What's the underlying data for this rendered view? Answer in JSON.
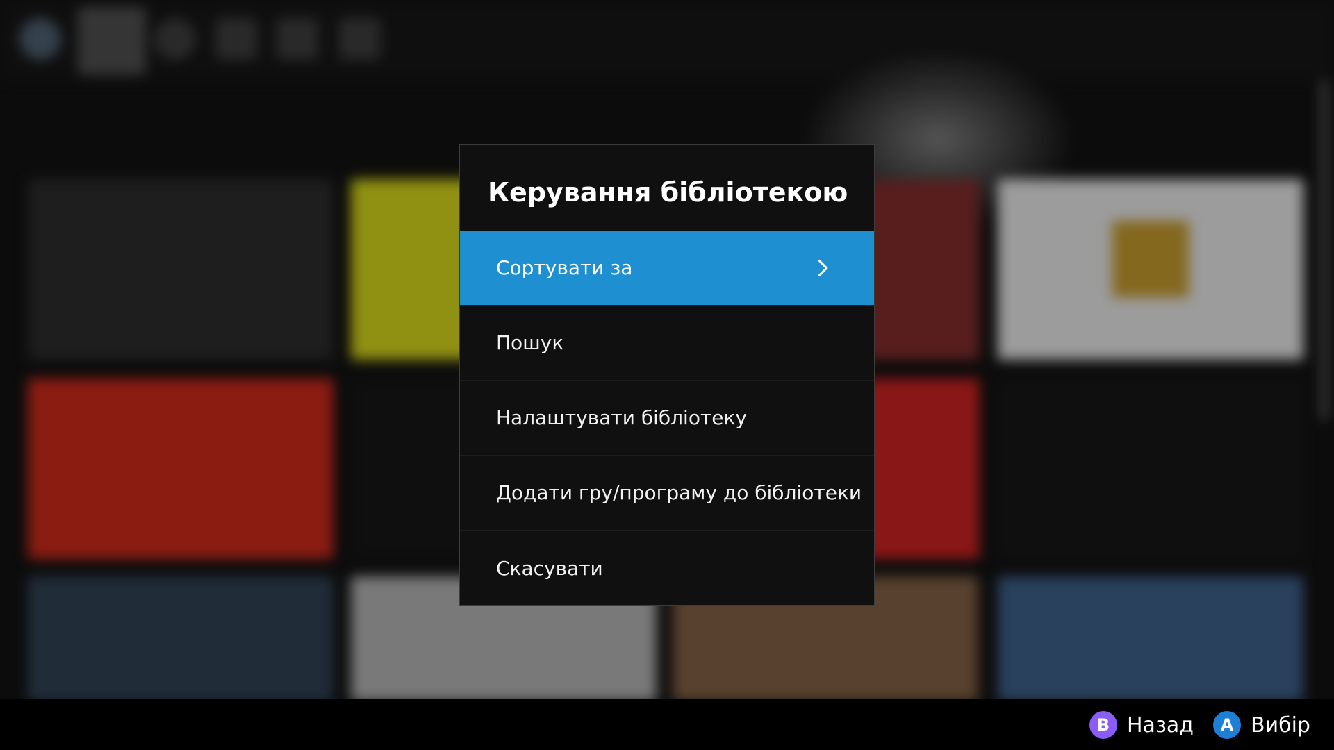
{
  "menu": {
    "title": "Керування бібліотекою",
    "items": [
      {
        "label": "Сортувати за",
        "selected": true,
        "has_submenu": true
      },
      {
        "label": "Пошук"
      },
      {
        "label": "Налаштувати бібліотеку"
      },
      {
        "label": "Додати гру/програму до бібліотеки"
      },
      {
        "label": "Скасувати"
      }
    ]
  },
  "hints": {
    "back": {
      "glyph": "B",
      "label": "Назад",
      "color": "#8b5cf6"
    },
    "select": {
      "glyph": "A",
      "label": "Вибір",
      "color": "#1e7fd6"
    }
  },
  "colors": {
    "accent": "#1e8fd0",
    "menu_bg": "#101010"
  },
  "icons": [
    "app-logo-icon",
    "library-icon",
    "globe-icon",
    "media-icon",
    "screen-icon",
    "controller-icon",
    "chevron-right-icon"
  ]
}
